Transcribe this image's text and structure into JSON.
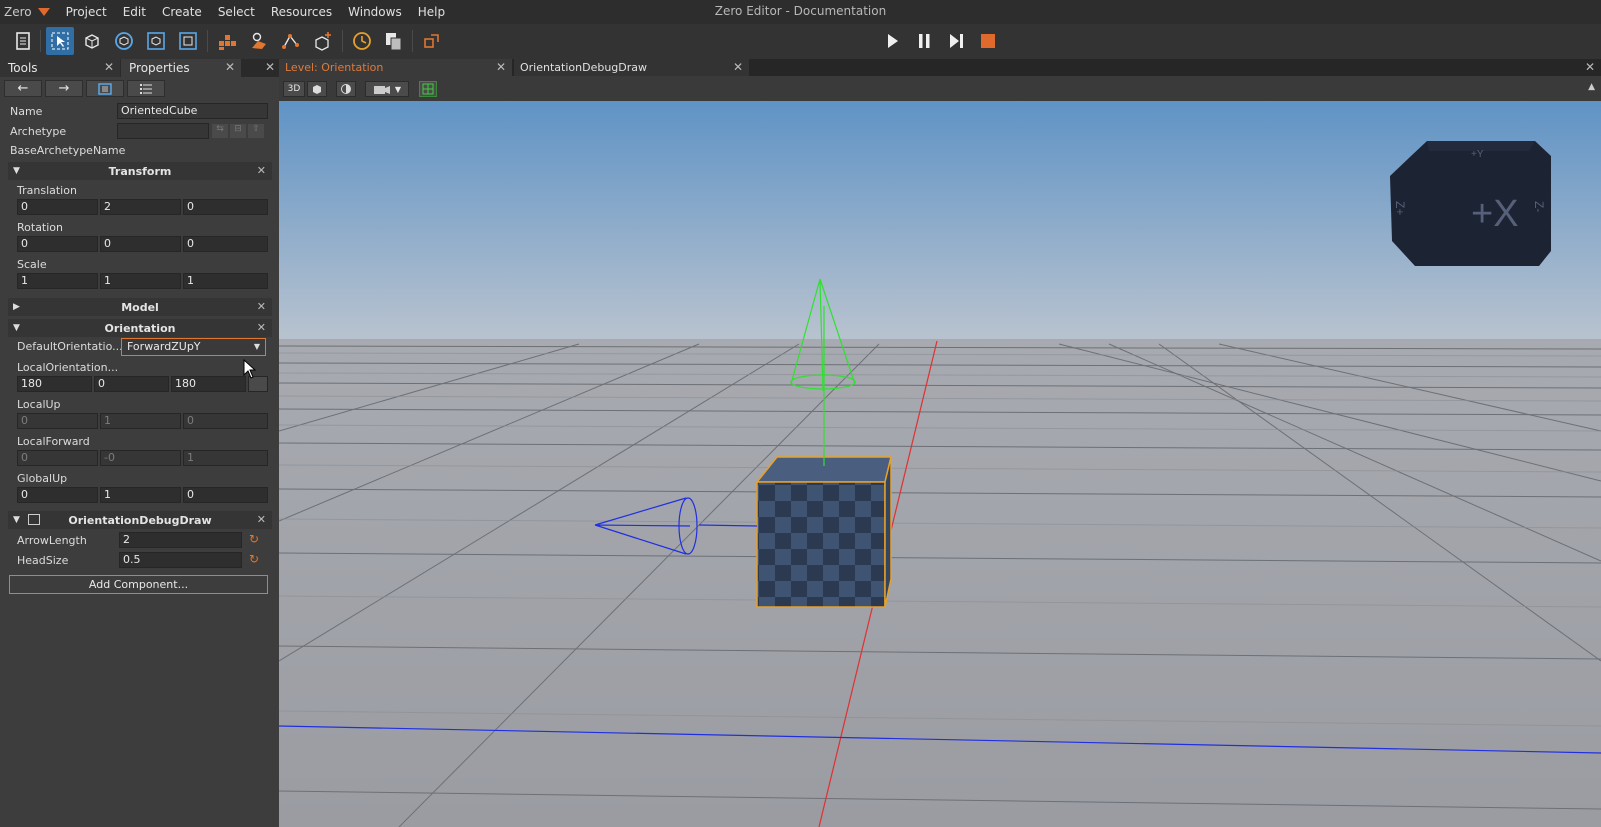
{
  "menu": {
    "logo": "Zero",
    "items": [
      "Project",
      "Edit",
      "Create",
      "Select",
      "Resources",
      "Windows",
      "Help"
    ],
    "title": "Zero Editor - Documentation"
  },
  "toolbar": {
    "icons": [
      "new-level-icon",
      "select-tool-icon",
      "translate-tool-icon",
      "rotate-tool-icon",
      "scale-tool-icon",
      "object-tool-icon",
      "tile-tool-icon",
      "spline-tool-icon",
      "path-tool-icon",
      "create-object-icon",
      "time-icon",
      "copy-icon",
      "reload-icon"
    ],
    "playback": [
      "play-icon",
      "pause-icon",
      "step-icon",
      "stop-icon"
    ]
  },
  "left_panel": {
    "tabs": {
      "tools": "Tools",
      "properties": "Properties"
    },
    "nav": [
      "←",
      "→"
    ],
    "name_label": "Name",
    "name_value": "OrientedCube",
    "archetype_label": "Archetype",
    "base_archetype_label": "BaseArchetypeName",
    "transform": {
      "title": "Transform",
      "translation_label": "Translation",
      "translation": [
        "0",
        "2",
        "0"
      ],
      "rotation_label": "Rotation",
      "rotation": [
        "0",
        "0",
        "0"
      ],
      "scale_label": "Scale",
      "scale": [
        "1",
        "1",
        "1"
      ]
    },
    "model": {
      "title": "Model"
    },
    "orientation": {
      "title": "Orientation",
      "default_label": "DefaultOrientatio...",
      "default_value": "ForwardZUpY",
      "local_orientation_label": "LocalOrientation...",
      "local_orientation": [
        "180",
        "0",
        "180"
      ],
      "local_up_label": "LocalUp",
      "local_up": [
        "0",
        "1",
        "0"
      ],
      "local_forward_label": "LocalForward",
      "local_forward": [
        "0",
        "-0",
        "1"
      ],
      "global_up_label": "GlobalUp",
      "global_up": [
        "0",
        "1",
        "0"
      ]
    },
    "debug_draw": {
      "title": "OrientationDebugDraw",
      "arrow_length_label": "ArrowLength",
      "arrow_length": "2",
      "head_size_label": "HeadSize",
      "head_size": "0.5"
    },
    "add_component": "Add Component..."
  },
  "doc_tabs": {
    "level": "Level: Orientation",
    "debug": "OrientationDebugDraw"
  },
  "viewport_toolbar": {
    "mode": "3D"
  },
  "view_cube": {
    "label": "+X",
    "side_left": "Z+",
    "side_right": "Z-",
    "top": "+Y"
  },
  "colors": {
    "accent": "#e0762f",
    "active_tool": "#2f6fa6",
    "sky_top": "#5f93c5",
    "ground": "#9c9fa6"
  }
}
